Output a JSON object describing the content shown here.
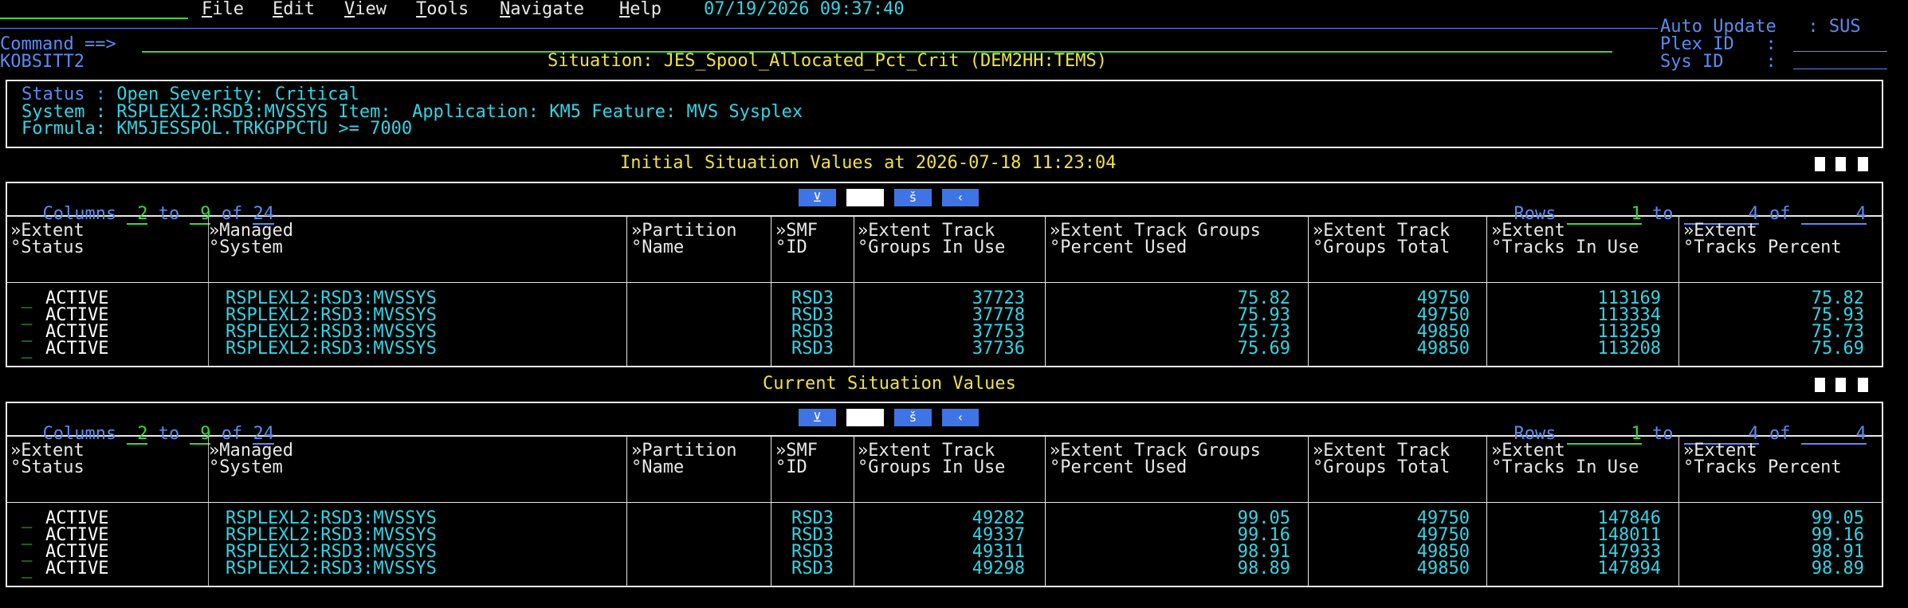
{
  "menu": {
    "items": [
      {
        "label": "File",
        "key": "F",
        "rest": "ile"
      },
      {
        "label": "Edit",
        "key": "E",
        "rest": "dit"
      },
      {
        "label": "View",
        "key": "V",
        "rest": "iew"
      },
      {
        "label": "Tools",
        "key": "T",
        "rest": "ools"
      },
      {
        "label": "Navigate",
        "key": "N",
        "rest": "avigate"
      },
      {
        "label": "Help",
        "key": "H",
        "rest": "elp"
      }
    ],
    "datetime": "07/19/2026 09:37:40"
  },
  "command_label": "Command ==>",
  "screen_id": "KOBSITT2",
  "situation_title": "Situation: JES_Spool_Allocated_Pct_Crit (DEM2HH:TEMS)",
  "right_info": {
    "auto_update": "Auto Update   : SUS",
    "plex_id": "Plex ID   :",
    "sys_id": "Sys ID    :"
  },
  "status_box": {
    "line1": "Status : Open Severity: Critical",
    "line2": "System : RSPLEXL2:RSD3:MVSSYS Item:  Application: KM5 Feature: MVS Sysplex",
    "line3": "Formula: KM5JESSPOL.TRKGPPCTU >= 7000"
  },
  "initial_title": "Initial Situation Values at 2026-07-18 11:23:04",
  "current_title": "Current Situation Values",
  "nav": {
    "columns_prefix": "Columns",
    "col_from": "2",
    "col_to_word": "to",
    "col_to": "9",
    "of_word": "of",
    "col_total": "24",
    "rows_prefix": "Rows",
    "row_from": "1",
    "row_to": "4",
    "row_total": "4"
  },
  "headers": [
    {
      "l1": "»Extent",
      "l2": "°Status"
    },
    {
      "l1": "»Managed",
      "l2": "°System"
    },
    {
      "l1": "»Partition",
      "l2": "°Name"
    },
    {
      "l1": "»SMF",
      "l2": "°ID"
    },
    {
      "l1": "»Extent Track",
      "l2": "°Groups In Use"
    },
    {
      "l1": "»Extent Track Groups",
      "l2": "°Percent Used"
    },
    {
      "l1": "»Extent Track",
      "l2": "°Groups Total"
    },
    {
      "l1": "»Extent",
      "l2": "°Tracks In Use"
    },
    {
      "l1": "»Extent",
      "l2": "°Tracks Percent"
    }
  ],
  "initial_rows": [
    {
      "status": "ACTIVE",
      "system": "RSPLEXL2:RSD3:MVSSYS",
      "partition": "",
      "smf": "RSD3",
      "in_use": "37723",
      "pct": "75.82",
      "total": "49750",
      "trk_in_use": "113169",
      "trk_pct": "75.82"
    },
    {
      "status": "ACTIVE",
      "system": "RSPLEXL2:RSD3:MVSSYS",
      "partition": "",
      "smf": "RSD3",
      "in_use": "37778",
      "pct": "75.93",
      "total": "49750",
      "trk_in_use": "113334",
      "trk_pct": "75.93"
    },
    {
      "status": "ACTIVE",
      "system": "RSPLEXL2:RSD3:MVSSYS",
      "partition": "",
      "smf": "RSD3",
      "in_use": "37753",
      "pct": "75.73",
      "total": "49850",
      "trk_in_use": "113259",
      "trk_pct": "75.73"
    },
    {
      "status": "ACTIVE",
      "system": "RSPLEXL2:RSD3:MVSSYS",
      "partition": "",
      "smf": "RSD3",
      "in_use": "37736",
      "pct": "75.69",
      "total": "49850",
      "trk_in_use": "113208",
      "trk_pct": "75.69"
    }
  ],
  "current_rows": [
    {
      "status": "ACTIVE",
      "system": "RSPLEXL2:RSD3:MVSSYS",
      "partition": "",
      "smf": "RSD3",
      "in_use": "49282",
      "pct": "99.05",
      "total": "49750",
      "trk_in_use": "147846",
      "trk_pct": "99.05"
    },
    {
      "status": "ACTIVE",
      "system": "RSPLEXL2:RSD3:MVSSYS",
      "partition": "",
      "smf": "RSD3",
      "in_use": "49337",
      "pct": "99.16",
      "total": "49750",
      "trk_in_use": "148011",
      "trk_pct": "99.16"
    },
    {
      "status": "ACTIVE",
      "system": "RSPLEXL2:RSD3:MVSSYS",
      "partition": "",
      "smf": "RSD3",
      "in_use": "49311",
      "pct": "98.91",
      "total": "49850",
      "trk_in_use": "147933",
      "trk_pct": "98.91"
    },
    {
      "status": "ACTIVE",
      "system": "RSPLEXL2:RSD3:MVSSYS",
      "partition": "",
      "smf": "RSD3",
      "in_use": "49298",
      "pct": "98.89",
      "total": "49850",
      "trk_in_use": "147894",
      "trk_pct": "98.89"
    }
  ],
  "colors": {
    "blue": "#5a8cf0",
    "cyan": "#2fd6e6",
    "yellow": "#f0e43a",
    "green": "#3ad63a",
    "white": "#e8e8e8",
    "chip": "#3f74e6"
  }
}
